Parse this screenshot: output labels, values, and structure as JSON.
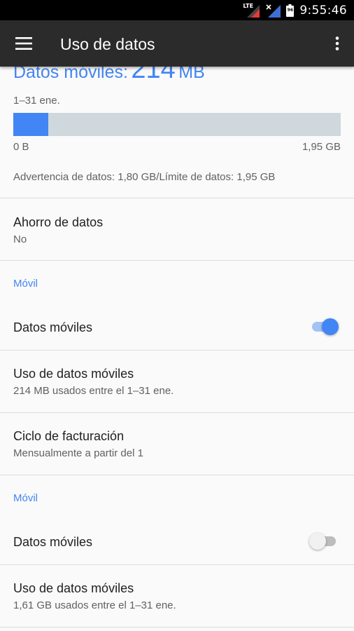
{
  "status_bar": {
    "network1_label": "LTE",
    "battery_label": "96",
    "time": "9:55:46"
  },
  "toolbar": {
    "title": "Uso de datos"
  },
  "summary": {
    "label": "Datos móviles:",
    "amount": "214",
    "unit": "MB",
    "period": "1–31 ene.",
    "usage_fraction": 0.107,
    "bar_min": "0 B",
    "bar_max": "1,95 GB",
    "warning_text": "Advertencia de datos: 1,80 GB/Límite de datos: 1,95 GB",
    "colors": {
      "accent": "#4285f4",
      "bar_track": "#cfd8dc"
    }
  },
  "data_saver": {
    "title": "Ahorro de datos",
    "value": "No"
  },
  "sim1": {
    "section_label": "Móvil",
    "mobile_data_label": "Datos móviles",
    "mobile_data_on": true,
    "usage_title": "Uso de datos móviles",
    "usage_sub": "214 MB usados entre el 1–31 ene.",
    "billing_title": "Ciclo de facturación",
    "billing_sub": "Mensualmente a partir del 1"
  },
  "sim2": {
    "section_label": "Móvil",
    "mobile_data_label": "Datos móviles",
    "mobile_data_on": false,
    "usage_title": "Uso de datos móviles",
    "usage_sub": "1,61 GB usados entre el 1–31 ene."
  }
}
